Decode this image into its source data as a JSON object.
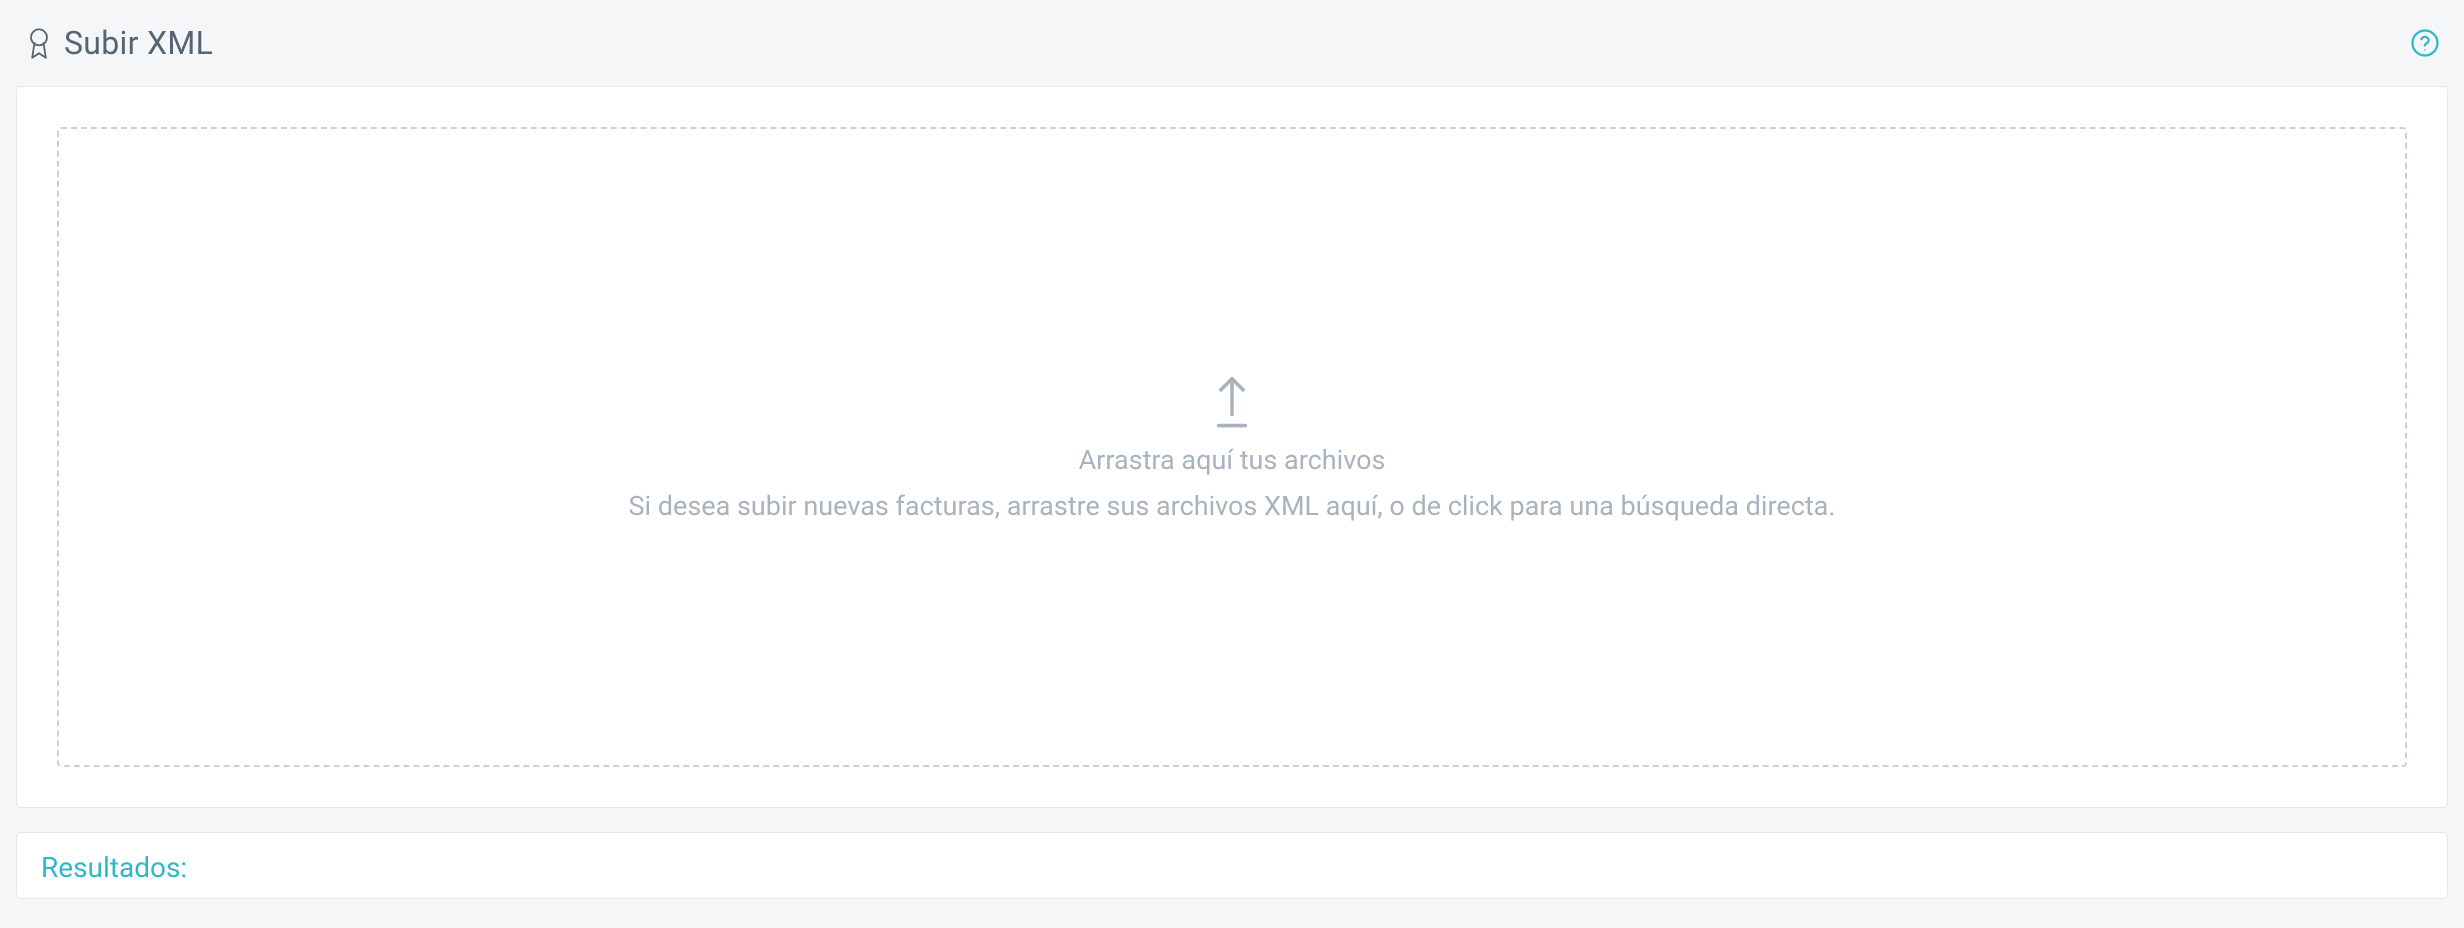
{
  "header": {
    "title": "Subir XML"
  },
  "dropzone": {
    "heading": "Arrastra aquí tus archivos",
    "subtext": "Si desea subir nuevas facturas, arrastre sus archivos XML aquí, o de click para una búsqueda directa."
  },
  "results": {
    "title": "Resultados:"
  },
  "colors": {
    "accent": "#2fb7c7",
    "text_muted": "#a8b3bf",
    "text_title": "#556472",
    "bg": "#f5f6f8"
  }
}
